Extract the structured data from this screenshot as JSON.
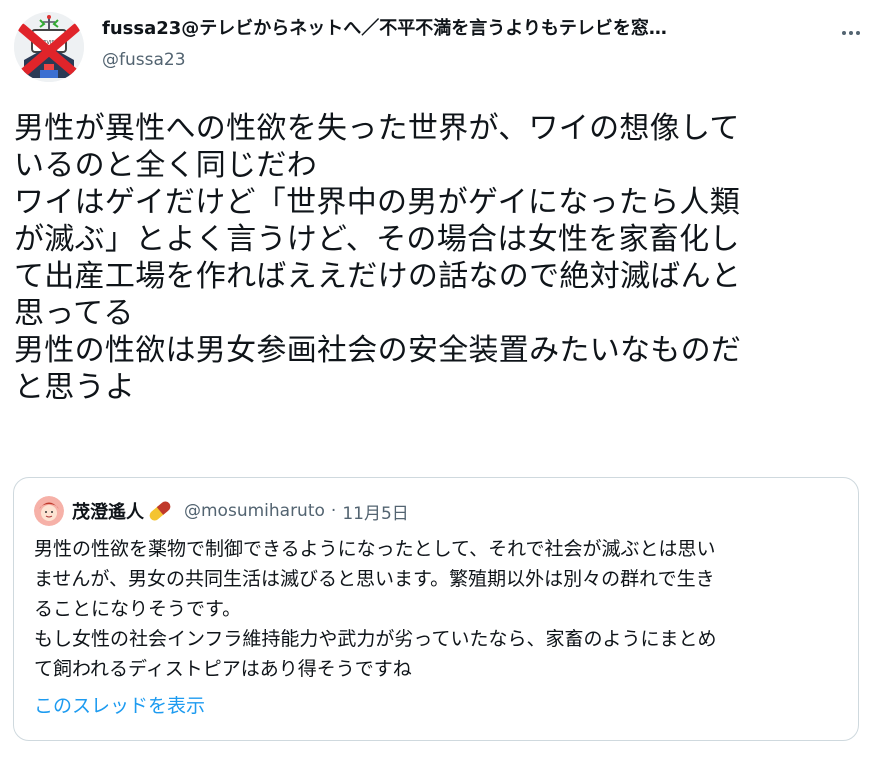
{
  "author": {
    "display_name": "fussa23@テレビからネットへ／不平不満を言うよりもテレビを窓…",
    "handle": "@fussa23",
    "avatar_icon": "no-tv-tower-icon"
  },
  "tweet": {
    "lines": [
      "男性が異性への性欲を失った世界が、ワイの想像して",
      "いるのと全く同じだわ",
      "ワイはゲイだけど「世界中の男がゲイになったら人類",
      "が滅ぶ」とよく言うけど、その場合は女性を家畜化し",
      "て出産工場を作ればええだけの話なので絶対滅ばんと",
      "思ってる",
      "男性の性欲は男女参画社会の安全装置みたいなものだ",
      "と思うよ"
    ]
  },
  "quote": {
    "display_name": "茂澄遙人",
    "name_emoji": "pill-icon",
    "handle": "@mosumiharuto",
    "separator": "·",
    "date": "11月5日",
    "lines": [
      "男性の性欲を薬物で制御できるようになったとして、それで社会が滅ぶとは思い",
      "ませんが、男女の共同生活は滅びると思います。繁殖期以外は別々の群れで生き",
      "ることになりそうです。",
      "もし女性の社会インフラ維持能力や武力が劣っていたなら、家畜のようにまとめ",
      "て飼われるディストピアはあり得そうですね"
    ],
    "show_thread": "このスレッドを表示"
  },
  "colors": {
    "text": "#0f1419",
    "secondary": "#536471",
    "link": "#1d9bf0",
    "border": "#cfd9de"
  }
}
